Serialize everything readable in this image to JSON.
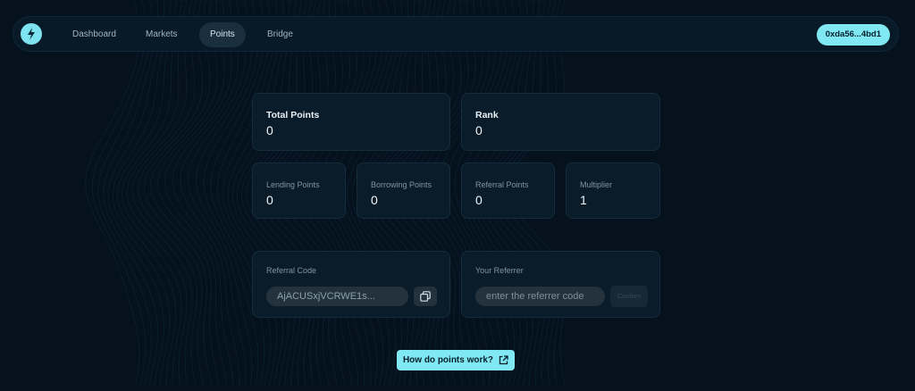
{
  "nav": {
    "items": [
      {
        "label": "Dashboard",
        "active": false
      },
      {
        "label": "Markets",
        "active": false
      },
      {
        "label": "Points",
        "active": true
      },
      {
        "label": "Bridge",
        "active": false
      }
    ],
    "wallet_label": "0xda56...4bd1",
    "logo_icon": "bolt-logo-icon"
  },
  "summary": {
    "total_points": {
      "label": "Total Points",
      "value": "0"
    },
    "rank": {
      "label": "Rank",
      "value": "0"
    }
  },
  "breakdown": [
    {
      "label": "Lending Points",
      "value": "0"
    },
    {
      "label": "Borrowing Points",
      "value": "0"
    },
    {
      "label": "Referral Points",
      "value": "0"
    },
    {
      "label": "Multiplier",
      "value": "1"
    }
  ],
  "referral_code": {
    "label": "Referral Code",
    "value": "AjACUSxjVCRWE1s...",
    "copy_icon": "copy-icon"
  },
  "referrer": {
    "label": "Your Referrer",
    "placeholder": "enter the referrer code",
    "confirm_label": "Confirm"
  },
  "how_button": {
    "label": "How do points work?",
    "icon": "external-link-icon"
  },
  "colors": {
    "background": "#05121d",
    "accent": "#7fe8f2",
    "card": "#0a1b29",
    "card_border": "#142c3c"
  }
}
